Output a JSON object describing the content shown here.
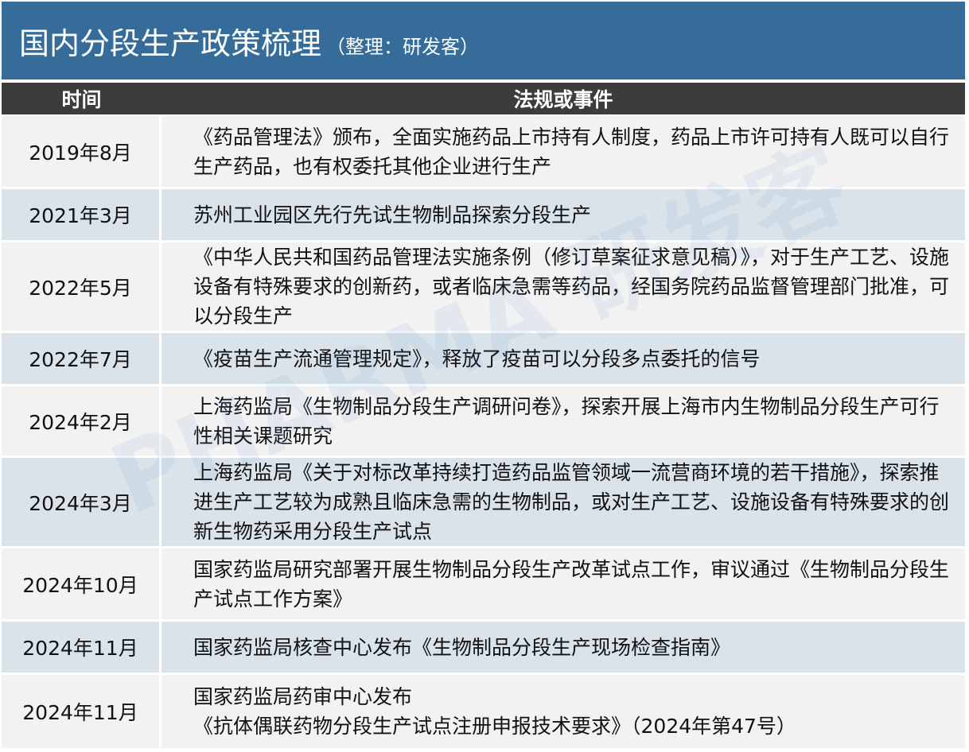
{
  "title": {
    "main": "国内分段生产政策梳理",
    "sub": "（整理：研发客）"
  },
  "header": {
    "time": "时间",
    "event": "法规或事件"
  },
  "rows": [
    {
      "time": "2019年8月",
      "event": "《药品管理法》颁布，全面实施药品上市持有人制度，药品上市许可持有人既可以自行生产药品，也有权委托其他企业进行生产"
    },
    {
      "time": "2021年3月",
      "event": "苏州工业园区先行先试生物制品探索分段生产"
    },
    {
      "time": "2022年5月",
      "event": "《中华人民共和国药品管理法实施条例（修订草案征求意见稿）》，对于生产工艺、设施设备有特殊要求的创新药，或者临床急需等药品，经国务院药品监督管理部门批准，可以分段生产"
    },
    {
      "time": "2022年7月",
      "event": "《疫苗生产流通管理规定》，释放了疫苗可以分段多点委托的信号"
    },
    {
      "time": "2024年2月",
      "event": "上海药监局《生物制品分段生产调研问卷》，探索开展上海市内生物制品分段生产可行性相关课题研究"
    },
    {
      "time": "2024年3月",
      "event": "上海药监局《关于对标改革持续打造药品监管领域一流营商环境的若干措施》，探索推进生产工艺较为成熟且临床急需的生物制品，或对生产工艺、设施设备有特殊要求的创新生物药采用分段生产试点"
    },
    {
      "time": "2024年10月",
      "event": "国家药监局研究部署开展生物制品分段生产改革试点工作，审议通过《生物制品分段生产试点工作方案》"
    },
    {
      "time": "2024年11月",
      "event": "国家药监局核查中心发布《生物制品分段生产现场检查指南》"
    },
    {
      "time": "2024年11月",
      "event": "国家药监局药审中心发布\n《抗体偶联药物分段生产试点注册申报技术要求》（2024年第47号）"
    }
  ],
  "watermark": "PHARMA 研发客",
  "colors": {
    "title_bg": "#356c99",
    "header_bg": "#3c3c3c",
    "row_light": "#f2f2f2",
    "row_blue": "#dbe3ea"
  }
}
